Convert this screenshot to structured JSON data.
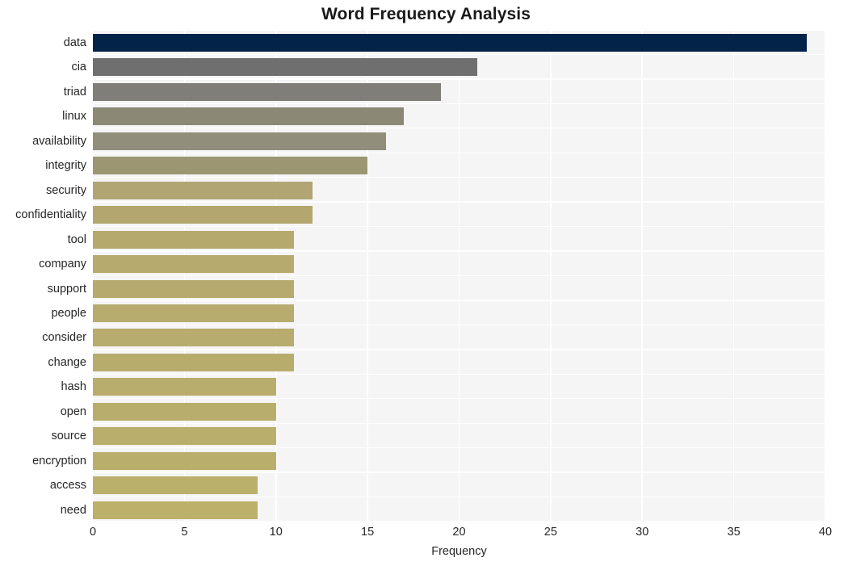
{
  "chart_data": {
    "type": "bar",
    "orientation": "horizontal",
    "title": "Word Frequency Analysis",
    "xlabel": "Frequency",
    "ylabel": "",
    "categories": [
      "data",
      "cia",
      "triad",
      "linux",
      "availability",
      "integrity",
      "security",
      "confidentiality",
      "tool",
      "company",
      "support",
      "people",
      "consider",
      "change",
      "hash",
      "open",
      "source",
      "encryption",
      "access",
      "need"
    ],
    "values": [
      39,
      21,
      19,
      17,
      16,
      15,
      12,
      12,
      11,
      11,
      11,
      11,
      11,
      11,
      10,
      10,
      10,
      10,
      9,
      9
    ],
    "bar_colors": [
      "#042349",
      "#706f70",
      "#7f7e79",
      "#8b8875",
      "#928e7c",
      "#9c9673",
      "#b0a573",
      "#b3a76f",
      "#b5a96e",
      "#b6aa6e",
      "#b6aa6e",
      "#b7ab6e",
      "#b7ab6e",
      "#b8ac6d",
      "#b9ad6d",
      "#b9ad6d",
      "#baae6c",
      "#baae6c",
      "#bbaf6c",
      "#bcb06b"
    ],
    "xlim": [
      0,
      40
    ],
    "xticks": [
      0,
      5,
      10,
      15,
      20,
      25,
      30,
      35,
      40
    ],
    "xtick_labels": [
      "0",
      "5",
      "10",
      "15",
      "20",
      "25",
      "30",
      "35",
      "40"
    ],
    "grid": true,
    "grid_color": "#ffffff",
    "plot_background": "#f5f5f6",
    "figure_background": "#ffffff",
    "legend": null
  }
}
